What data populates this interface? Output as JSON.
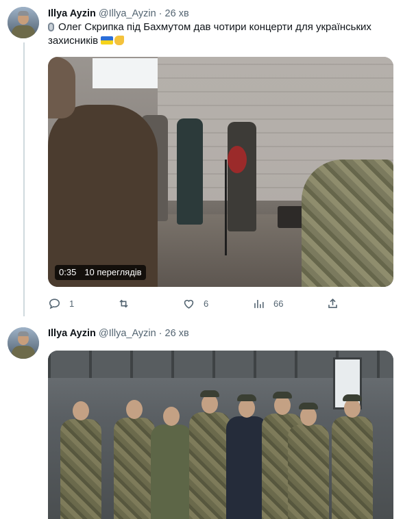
{
  "tweets": [
    {
      "author": {
        "name": "Illya Ayzin",
        "handle": "@Illya_Ayzin",
        "separator": "·",
        "time": "26 хв"
      },
      "text": "Олег Скрипка під Бахмутом дав чотири концерти для українських захисників",
      "emojis": [
        "microphone-icon",
        "ukraine-flag-icon",
        "flexed-biceps-icon"
      ],
      "video": {
        "duration": "0:35",
        "views": "10 переглядів"
      },
      "actions": {
        "reply_count": "1",
        "retweet_count": "",
        "like_count": "6",
        "views_count": "66"
      }
    },
    {
      "author": {
        "name": "Illya Ayzin",
        "handle": "@Illya_Ayzin",
        "separator": "·",
        "time": "26 хв"
      }
    }
  ],
  "colors": {
    "text": "#0f1419",
    "secondary": "#536471",
    "thread_line": "#cfd9de"
  }
}
